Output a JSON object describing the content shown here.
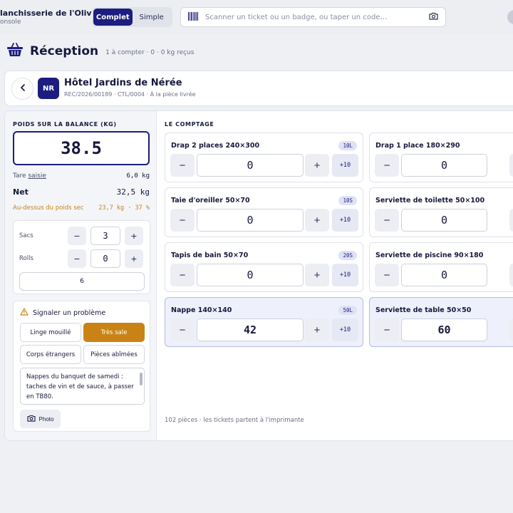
{
  "app": {
    "brand_title": "lanchisserie de l'Oliveraie",
    "brand_sub": "onsole",
    "modes": [
      "Complet",
      "Simple"
    ],
    "active_mode": "Complet",
    "scan_placeholder": "Scanner un ticket ou un badge, ou taper un code…"
  },
  "page": {
    "title": "Réception",
    "meta": "1 à compter · 0 · 0 kg reçus"
  },
  "client": {
    "initials": "NR",
    "name": "Hôtel Jardins de Nérée",
    "meta": "REC/2026/00189 · CTL/0004 · À la pièce livrée"
  },
  "scale": {
    "label": "POIDS SUR LA BALANCE (KG)",
    "value": "38.5",
    "tare_label": "Tare",
    "tare_link": "saisie",
    "tare_value": "6,0 kg",
    "net_label": "Net",
    "net_value": "32,5 kg",
    "over_label": "Au-dessus du poids sec",
    "over_value": "23,7 kg · 37 %"
  },
  "bags": {
    "sacs_label": "Sacs",
    "sacs_value": "3",
    "rolls_label": "Rolls",
    "rolls_value": "0",
    "total": "6"
  },
  "problem": {
    "title": "Signaler un problème",
    "chips": [
      "Linge mouillé",
      "Très sale",
      "Corps étrangers",
      "Pièces abîmées"
    ],
    "active_chip": "Très sale",
    "note": "Nappes du banquet de samedi : taches de vin et de sauce, à passer en TB80.",
    "photo_label": "Photo"
  },
  "counting": {
    "label": "LE COMPTAGE",
    "plus10_label": "+10",
    "items": [
      {
        "name": "Drap 2 places 240×300",
        "tag": "10L",
        "qty": "0"
      },
      {
        "name": "Drap 1 place 180×290",
        "tag": "",
        "qty": "0"
      },
      {
        "name": "Taie d'oreiller 50×70",
        "tag": "10S",
        "qty": "0"
      },
      {
        "name": "Serviette de toilette 50×100",
        "tag": "",
        "qty": "0"
      },
      {
        "name": "Tapis de bain 50×70",
        "tag": "20S",
        "qty": "0"
      },
      {
        "name": "Serviette de piscine 90×180",
        "tag": "",
        "qty": "0"
      },
      {
        "name": "Nappe 140×140",
        "tag": "50L",
        "qty": "42"
      },
      {
        "name": "Serviette de table 50×50",
        "tag": "",
        "qty": "60"
      }
    ],
    "footer": "102 pièces · les tickets partent à l'imprimante"
  },
  "colors": {
    "primary": "#1c1d7f",
    "accent": "#c98314",
    "filled_card": "#eef0fb"
  }
}
